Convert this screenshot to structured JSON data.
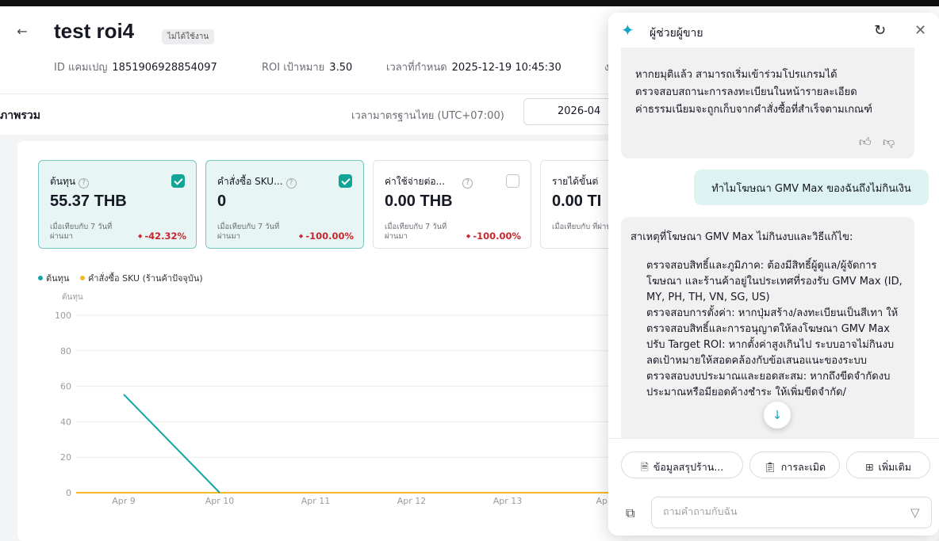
{
  "header": {
    "back_icon": "arrow-left-icon",
    "title": "test roi4",
    "status": "ไม่ได้ใช้งาน",
    "id_label": "ID แคมเปญ",
    "id_value": "1851906928854097",
    "roi_label": "ROI เป้าหมาย",
    "roi_value": "3.50",
    "time_label": "เวลาที่กำหนด",
    "time_value": "2025-12-19 10:45:30",
    "truncated": "ง"
  },
  "overview": {
    "title": "ภาพรวม",
    "timezone": "เวลามาตรฐานไทย (UTC+07:00)",
    "date": "2026-04"
  },
  "metrics": [
    {
      "label": "ต้นทุน",
      "value": "55.37 THB",
      "compare": "เมื่อเทียบกับ 7 วันที่ผ่านมา",
      "change": "-42.32%",
      "checked": true
    },
    {
      "label": "คำสั่งซื้อ SKU...",
      "value": "0",
      "compare": "เมื่อเทียบกับ 7 วันที่ผ่านมา",
      "change": "-100.00%",
      "checked": true
    },
    {
      "label": "ค่าใช้จ่ายต่อ...",
      "value": "0.00 THB",
      "compare": "เมื่อเทียบกับ 7 วันที่ผ่านมา",
      "change": "-100.00%",
      "checked": false
    },
    {
      "label": "รายได้ขั้นต่",
      "value": "0.00 TI",
      "compare": "เมื่อเทียบกับ ที่ผ่านมา",
      "change": "",
      "checked": false
    }
  ],
  "legend": {
    "series1": "ต้นทุน",
    "series2": "คำสั่งซื้อ SKU (ร้านค้าปัจจุบัน)"
  },
  "chart_data": {
    "type": "line",
    "ylabel": "ต้นทุน",
    "ylim": [
      0,
      100
    ],
    "yticks": [
      "0",
      "20",
      "40",
      "60",
      "80",
      "100"
    ],
    "categories": [
      "Apr 9",
      "Apr 10",
      "Apr 11",
      "Apr 12",
      "Apr 13",
      "Apr"
    ],
    "series": [
      {
        "name": "ต้นทุน",
        "color": "#13a6a0",
        "values": [
          55.37,
          0,
          null,
          null,
          null,
          null
        ]
      },
      {
        "name": "คำสั่งซื้อ SKU (ร้านค้าปัจจุบัน)",
        "color": "#f5b829",
        "values": [
          0,
          0,
          0,
          0,
          0,
          0
        ]
      }
    ],
    "grid": true
  },
  "assistant": {
    "title": "ผู้ช่วยผู้ขาย",
    "first_message": "หากยมุติแล้ว สามารถเริ่มเข้าร่วมโปรแกรมได้\nตรวจสอบสถานะการลงทะเบียนในหน้ารายละเอียด\nค่าธรรมเนียมจะถูกเก็บจากคำสั่งซื้อที่สำเร็จตามเกณฑ์",
    "user_message": "ทำไมโฆษณา GMV Max ของฉันถึงไม่กินเงิน",
    "reply_intro": "สาเหตุที่โฆษณา GMV Max ไม่กินงบและวิธีแก้ไข:",
    "reply_body": "ตรวจสอบสิทธิ์และภูมิภาค: ต้องมีสิทธิ์ผู้ดูแล/ผู้จัดการโฆษณา และร้านค้าอยู่ในประเทศที่รองรับ GMV Max (ID, MY, PH, TH, VN, SG, US)\nตรวจสอบการตั้งค่า: หากปุ่มสร้าง/ลงทะเบียนเป็นสีเทา ให้ตรวจสอบสิทธิ์และการอนุญาตให้ลงโฆษณา GMV Max\nปรับ Target ROI: หากตั้งค่าสูงเกินไป ระบบอาจไม่กินงบ ลดเป้าหมายให้สอดคล้องกับข้อเสนอแนะของระบบ\nตรวจสอบงบประมาณและยอดสะสม: หากถึงขีดจำกัดงบประมาณหรือมียอดค้างชำระ ให้เพิ่มขีดจำกัด/",
    "chips": [
      {
        "label": "ข้อมูลสรุปร้าน...",
        "icon": "document-icon"
      },
      {
        "label": "การละเมิด",
        "icon": "clipboard-alert-icon"
      },
      {
        "label": "เพิ่มเติม",
        "icon": "grid-icon"
      }
    ],
    "input_placeholder": "ถามคำถามกับฉัน"
  }
}
